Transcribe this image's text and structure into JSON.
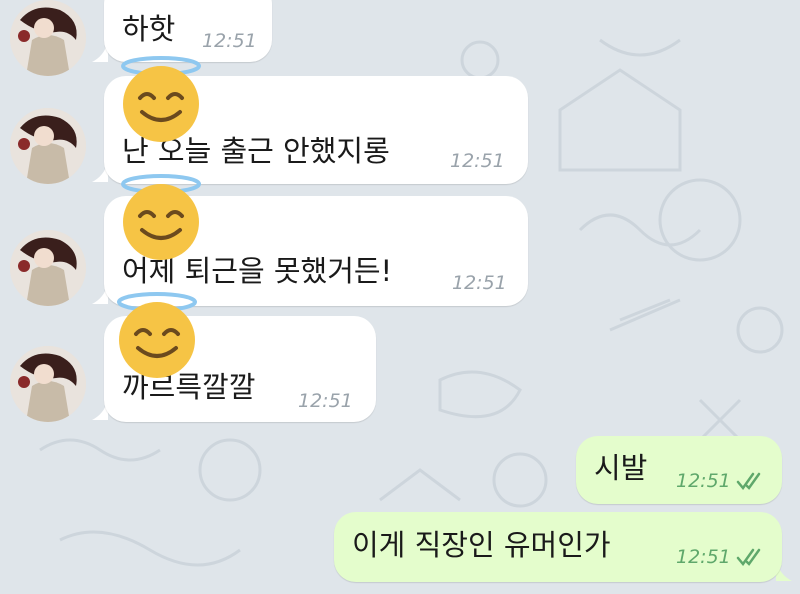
{
  "colors": {
    "background": "#dfe5ea",
    "incoming_bubble": "#ffffff",
    "outgoing_bubble": "#e4fdcc",
    "outgoing_time": "#5fa86b",
    "read_check": "#5fa86b",
    "emoji_face": "#f6c445",
    "halo": "#8ec8f0"
  },
  "messages": [
    {
      "direction": "incoming",
      "text": "하핫",
      "time": "12:51"
    },
    {
      "direction": "incoming",
      "emoji": "smiling-face-with-halo",
      "text": "난 오늘 출근 안했지롱",
      "time": "12:51"
    },
    {
      "direction": "incoming",
      "emoji": "smiling-face-with-halo",
      "text": "어제 퇴근을 못했거든!",
      "time": "12:51"
    },
    {
      "direction": "incoming",
      "emoji": "smiling-face-with-halo",
      "text": "까르륵깔깔",
      "time": "12:51"
    },
    {
      "direction": "outgoing",
      "text": "시발",
      "time": "12:51",
      "status": "read"
    },
    {
      "direction": "outgoing",
      "text": "이게 직장인 유머인가",
      "time": "12:51",
      "status": "read"
    }
  ]
}
